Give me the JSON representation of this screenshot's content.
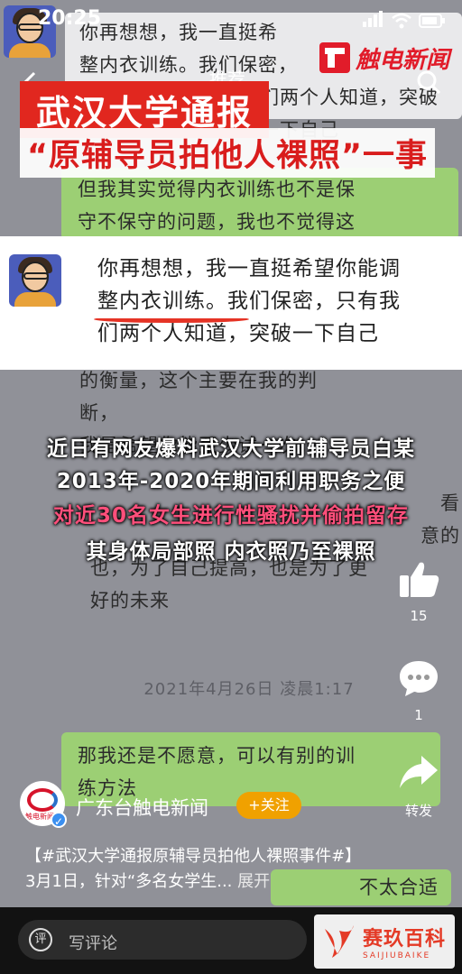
{
  "status_bar": {
    "time": "20:25"
  },
  "nav": {
    "title": "推荐"
  },
  "brand": {
    "name": "触电新闻"
  },
  "headline": {
    "line1": "武汉大学通报",
    "line2": "“原辅导员拍他人裸照”一事"
  },
  "chat": {
    "bubble_top_1": "你再想想，我一直挺希",
    "bubble_top_2": "整内衣训练。我们保密，",
    "bubble_top_3": "们两个人知道，突破一下自己",
    "bubble_green_1": "但我其实觉得内衣训练也不是保",
    "bubble_green_2": "守不保守的问题，我也不觉得这",
    "bubble_mid_1": "的衡量，这个主要在我的判断，",
    "bubble_mid_2": "我是希望你能至少试一次。",
    "bubble_mid_3": "也，为了自己提高，也是为了更",
    "bubble_mid_4": "好的未来",
    "bubble_right_1": "看",
    "bubble_right_2": "意的",
    "timestamp": "2021年4月26日 凌晨1:17",
    "bubble_bottom_1": "那我还是不愿意，可以有别的训",
    "bubble_bottom_2": "练方法",
    "bubble_bottom_3": "不太合适"
  },
  "quote": {
    "line1": "你再想想，我一直挺希望你能调",
    "line2": "整内衣训练。我们保密，只有我",
    "line3": "们两个人知道，突破一下自己"
  },
  "captions": {
    "line1": "近日有网友爆料武汉大学前辅导员白某",
    "line2": "2013年-2020年期间利用职务之便",
    "line3": "对近30名女生进行性骚扰并偷拍留存",
    "line4": "其身体局部照 内衣照乃至裸照"
  },
  "rail": {
    "like_count": "15",
    "comment_count": "1",
    "share_label": "转发"
  },
  "author": {
    "name": "广东台触电新闻",
    "logo_text": "触电新闻",
    "follow_label": "+关注"
  },
  "description": {
    "text": "【#武汉大学通报原辅导员拍他人裸照事件#】3月1日，针对“多名女学生...",
    "expand_label": "展开"
  },
  "bottom": {
    "comment_placeholder": "写评论",
    "comment_icon_glyph": "评"
  },
  "watermark": {
    "cn": "赛玖百科",
    "en": "SAIJIUBAIKE"
  },
  "colors": {
    "headline_red": "#e1271f",
    "caption_pink": "#ff4f7b",
    "follow_orange": "#f0a100",
    "chat_green": "#9ccf74"
  }
}
